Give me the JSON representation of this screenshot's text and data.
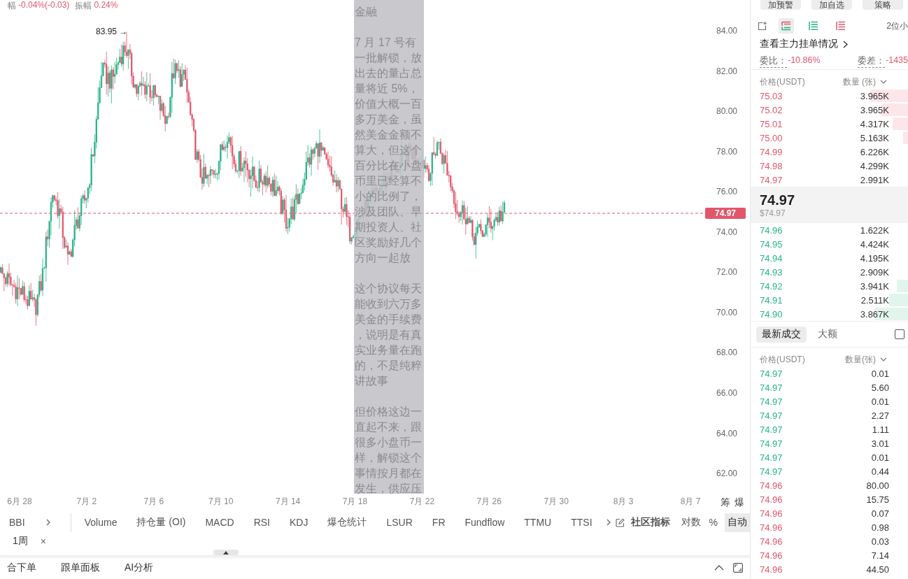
{
  "header": [
    {
      "label": "幅",
      "value": "-0.04%(-0.03)"
    },
    {
      "label": "振幅",
      "value": "0.24%"
    }
  ],
  "chart": {
    "high_marker": "83.95 →",
    "price_tag": "74.97",
    "y_labels": [
      "84.00",
      "82.00",
      "80.00",
      "78.00",
      "76.00",
      "74.00",
      "72.00",
      "70.00",
      "68.00",
      "66.00",
      "64.00",
      "62.00"
    ],
    "x_labels": [
      "6月 28",
      "7月 2",
      "7月 6",
      "7月 10",
      "7月 14",
      "7月 18",
      "7月 22",
      "7月 26",
      "7月 30",
      "8月 3",
      "8月 7"
    ],
    "toggles": [
      "筹",
      "爆"
    ]
  },
  "note": {
    "paragraphs": [
      "金融",
      "7 月 17 号有一批解锁，放出去的量占总量将近 5%，价值大概一百多万美金，虽然美金金额不算大，但这个百分比在小盘币里已经算不小的比例了，涉及团队、早期投资人、社区奖励好几个方向一起放",
      "这个协议每天能收到六万多美金的手续费，说明是有真实业务量在跑的，不是纯粹讲故事",
      "但价格这边一直起不来，跟很多小盘币一样，解锁这个事情按月都在发生，供应压"
    ]
  },
  "indicator_bar": {
    "main_indicators": [
      "BBI"
    ],
    "sub_indicators": [
      "Volume",
      "持仓量 (OI)",
      "MACD",
      "RSI",
      "KDJ",
      "爆仓统计",
      "LSUR",
      "FR",
      "Fundflow",
      "TTMU",
      "TTSI"
    ],
    "community_label": "社区指标",
    "scale_options": [
      {
        "label": "对数",
        "selected": false
      },
      {
        "label": "%",
        "selected": false
      },
      {
        "label": "自动",
        "selected": true
      }
    ]
  },
  "interval_tags": [
    {
      "label": "1周",
      "close": "×"
    }
  ],
  "bottom_tabs": [
    "合下单",
    "跟单面板",
    "AI分析"
  ],
  "side_panel": {
    "actions": [
      "加预警",
      "加自选",
      "策略"
    ],
    "view_modes": [
      {
        "kind": "both",
        "selected": true
      },
      {
        "kind": "bids",
        "selected": false
      },
      {
        "kind": "asks",
        "selected": false
      }
    ],
    "precision": "2位小",
    "main_orders_link": "查看主力挂单情况",
    "ratio": {
      "label": "委比：",
      "value": "-10.86%"
    },
    "delta": {
      "label": "委差：",
      "value": "-1435"
    },
    "book_columns": [
      "价格(USDT)",
      "数量 (张)"
    ],
    "asks": [
      {
        "price": "75.03",
        "amount": "3.965K",
        "level": 0.24
      },
      {
        "price": "75.02",
        "amount": "3.965K",
        "level": 0.17
      },
      {
        "price": "75.01",
        "amount": "4.317K",
        "level": 0.1
      },
      {
        "price": "75.00",
        "amount": "5.163K",
        "level": 0.03
      },
      {
        "price": "74.99",
        "amount": "6.226K"
      },
      {
        "price": "74.98",
        "amount": "4.299K"
      },
      {
        "price": "74.97",
        "amount": "2.991K"
      }
    ],
    "last_price": "74.97",
    "last_price_usd": "$74.97",
    "bids": [
      {
        "price": "74.96",
        "amount": "1.622K"
      },
      {
        "price": "74.95",
        "amount": "4.424K"
      },
      {
        "price": "74.94",
        "amount": "4.195K"
      },
      {
        "price": "74.93",
        "amount": "2.909K"
      },
      {
        "price": "74.92",
        "amount": "3.941K",
        "level": 0.07
      },
      {
        "price": "74.91",
        "amount": "2.511K",
        "level": 0.12
      },
      {
        "price": "74.90",
        "amount": "3.867K",
        "level": 0.21
      }
    ],
    "trade_tabs": [
      {
        "label": "最新成交",
        "selected": true
      },
      {
        "label": "大额",
        "selected": false
      }
    ],
    "filter_checkbox": {
      "checked": false
    },
    "trade_columns": [
      "价格(USDT)",
      "数量(张)"
    ],
    "trades": [
      {
        "price": "74.97",
        "amount": "0.01",
        "color": "#25b386"
      },
      {
        "price": "74.97",
        "amount": "5.60",
        "color": "#25b386"
      },
      {
        "price": "74.97",
        "amount": "0.01",
        "color": "#25b386"
      },
      {
        "price": "74.97",
        "amount": "2.27",
        "color": "#25b386"
      },
      {
        "price": "74.97",
        "amount": "1.11",
        "color": "#25b386"
      },
      {
        "price": "74.97",
        "amount": "3.01",
        "color": "#25b386"
      },
      {
        "price": "74.97",
        "amount": "0.01",
        "color": "#25b386"
      },
      {
        "price": "74.97",
        "amount": "0.44",
        "color": "#25b386"
      },
      {
        "price": "74.96",
        "amount": "80.00",
        "color": "#e1566b"
      },
      {
        "price": "74.96",
        "amount": "15.75",
        "color": "#e1566b"
      },
      {
        "price": "74.96",
        "amount": "0.07",
        "color": "#e1566b"
      },
      {
        "price": "74.96",
        "amount": "0.98",
        "color": "#e1566b"
      },
      {
        "price": "74.96",
        "amount": "0.03",
        "color": "#e1566b"
      },
      {
        "price": "74.96",
        "amount": "7.14",
        "color": "#e1566b"
      },
      {
        "price": "74.96",
        "amount": "44.50",
        "color": "#e1566b"
      }
    ]
  }
}
